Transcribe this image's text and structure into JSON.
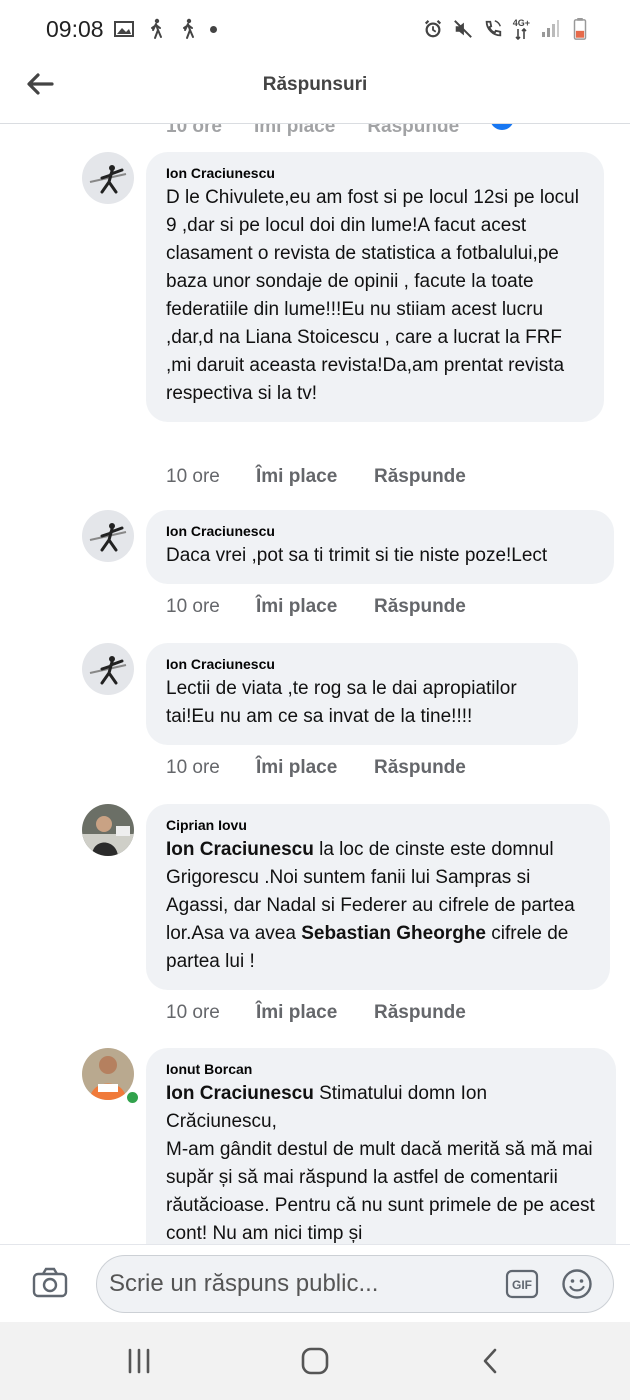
{
  "status_bar": {
    "time": "09:08",
    "left_icons": [
      "image-icon",
      "walking-icon",
      "walking-icon",
      "dot-icon"
    ],
    "right_icons": [
      "alarm-icon",
      "mute-icon",
      "wifi-call-icon",
      "network-4g-icon",
      "signal-icon",
      "battery-icon"
    ],
    "network_label": "4G+"
  },
  "header": {
    "title": "Răspunsuri",
    "back_icon": "arrow-left-icon"
  },
  "comments": [
    {
      "author": "Ion Craciunescu",
      "avatar": "silhouette-avatar",
      "segments": [
        {
          "text": "D le Chivulete,eu am fost si pe locul 12si pe locul 9 ,dar si pe locul doi din lume!A facut acest clasament o revista de statistica a fotbalului,pe baza unor sondaje de opinii , facute la toate federatiile din lume!!!Eu nu stiiam acest lucru ,dar,d na Liana Stoicescu , care a lucrat la FRF ,mi daruit aceasta revista!Da,am prentat revista respectiva si la tv!",
          "bold": false
        }
      ],
      "time": "10 ore",
      "like_label": "Îmi place",
      "reply_label": "Răspunde"
    },
    {
      "author": "Ion Craciunescu",
      "avatar": "silhouette-avatar",
      "segments": [
        {
          "text": "Daca vrei ,pot sa ti trimit si tie niste poze!Lect",
          "bold": false
        }
      ],
      "time": "10 ore",
      "like_label": "Îmi place",
      "reply_label": "Răspunde"
    },
    {
      "author": "Ion Craciunescu",
      "avatar": "silhouette-avatar",
      "segments": [
        {
          "text": "Lectii de viata ,te rog sa le dai apropiatilor tai!Eu nu am ce sa invat de la tine!!!!",
          "bold": false
        }
      ],
      "time": "10 ore",
      "like_label": "Îmi place",
      "reply_label": "Răspunde"
    },
    {
      "author": "Ciprian Iovu",
      "avatar": "photo-avatar",
      "segments": [
        {
          "text": "Ion Craciunescu",
          "bold": true
        },
        {
          "text": " la loc de cinste este domnul Grigorescu .Noi suntem fanii lui Sampras si Agassi, dar Nadal si Federer au cifrele de partea lor.Asa va avea ",
          "bold": false
        },
        {
          "text": "Sebastian Gheorghe",
          "bold": true
        },
        {
          "text": " cifrele de partea lui  !",
          "bold": false
        }
      ],
      "time": "10 ore",
      "like_label": "Îmi place",
      "reply_label": "Răspunde"
    },
    {
      "author": "Ionut Borcan",
      "avatar": "photo-avatar",
      "online": true,
      "segments": [
        {
          "text": "Ion Craciunescu",
          "bold": true
        },
        {
          "text": " Stimatului domn Ion Crăciunescu,\nM-am gândit destul de mult dacă merită să mă mai supăr și să mai răspund la astfel de comentarii răutăcioase. Pentru că nu sunt primele de pe acest cont! Nu am nici timp și",
          "bold": false
        }
      ]
    }
  ],
  "composer": {
    "placeholder": "Scrie un răspuns public...",
    "camera_icon": "camera-icon",
    "gif_icon": "gif-icon",
    "emoji_icon": "emoji-icon"
  },
  "navbar": {
    "icons": [
      "recent-apps-icon",
      "home-icon",
      "back-icon"
    ]
  },
  "colors": {
    "bubble": "#f0f2f5",
    "meta_text": "#65676b",
    "online": "#31a24c",
    "accent": "#1877f2"
  }
}
